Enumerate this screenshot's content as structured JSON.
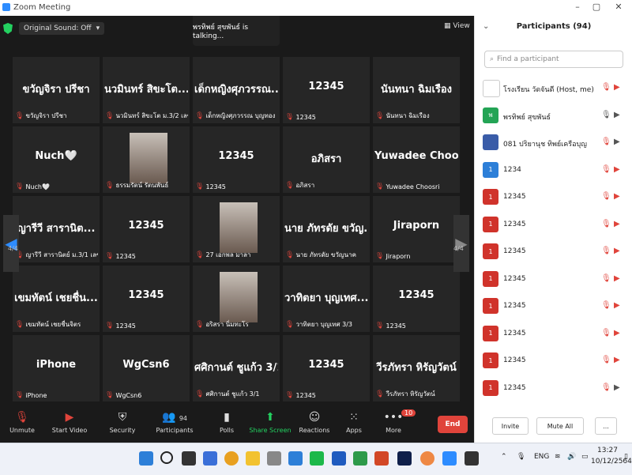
{
  "window": {
    "title": "Zoom Meeting"
  },
  "topbar": {
    "original_sound": "Original Sound: Off",
    "talking": "พรทิพย์ สุขพันธ์ is talking...",
    "view": "View"
  },
  "tiles": [
    {
      "name": "ขวัญจิรา ปรีชา",
      "label": "ขวัญจิรา ปรีชา"
    },
    {
      "name": "นวมินทร์ สิขะโต...",
      "label": "นวมินทร์ สิขะโต ม.3/2 เลขที่28"
    },
    {
      "name": "เด็กหญิงศุภวรรณ...",
      "label": "เด็กหญิงศุภวรรณ บุญทอง"
    },
    {
      "name": "12345",
      "label": "12345"
    },
    {
      "name": "นันทนา ฉิมเรือง",
      "label": "นันทนา ฉิมเรือง"
    },
    {
      "name": "Nuch🤍",
      "label": "Nuch🤍"
    },
    {
      "name": "",
      "label": "ธรรมรัตน์ รัตนพันธ์",
      "photo": true
    },
    {
      "name": "12345",
      "label": "12345"
    },
    {
      "name": "อภิสรา",
      "label": "อภิสรา"
    },
    {
      "name": "Yuwadee Choosri",
      "label": "Yuwadee Choosri"
    },
    {
      "name": "ญารีวี สารานิต...",
      "label": "ญารีวี สารานิตย์ ม.3/1 เลข..."
    },
    {
      "name": "12345",
      "label": "12345"
    },
    {
      "name": "",
      "label": "27 เอกพล มาลา",
      "photo": true
    },
    {
      "name": "นาย ภัทรดัย ขวัญ...",
      "label": "นาย ภัทรดัย ขวัญนาค"
    },
    {
      "name": "Jiraporn",
      "label": "Jiraporn"
    },
    {
      "name": "เขมทัตน์ เชยชื่น...",
      "label": "เขมทัตน์ เชยชื่นจิตร"
    },
    {
      "name": "12345",
      "label": "12345"
    },
    {
      "name": "",
      "label": "อริสรา นิ่มทะโร",
      "photo": true
    },
    {
      "name": "วาทิตยา บุญเทศ...",
      "label": "วาทิตยา บุญเทศ 3/3"
    },
    {
      "name": "12345",
      "label": "12345"
    },
    {
      "name": "iPhone",
      "label": "iPhone"
    },
    {
      "name": "WgCsn6",
      "label": "WgCsn6"
    },
    {
      "name": "ศศิกานต์ ชูแก้ว 3/1",
      "label": "ศศิกานต์ ชูแก้ว 3/1"
    },
    {
      "name": "12345",
      "label": "12345"
    },
    {
      "name": "วีรภัทรา หิรัญวัตน์",
      "label": "วีรภัทรา หิรัญวัตน์"
    }
  ],
  "pager": {
    "left": "4/4",
    "right": "4/4"
  },
  "toolbar": {
    "unmute": "Unmute",
    "start_video": "Start Video",
    "security": "Security",
    "participants": "Participants",
    "participants_count": "94",
    "polls": "Polls",
    "share": "Share Screen",
    "reactions": "Reactions",
    "apps": "Apps",
    "more": "More",
    "more_badge": "10",
    "end": "End"
  },
  "panel": {
    "title": "Participants (94)",
    "search_placeholder": "Find a participant",
    "participants": [
      {
        "name": "โรงเรียน วัดจันดี (Host, me)",
        "color": "#ffffff",
        "avatar": "",
        "mic": "off",
        "cam": "off"
      },
      {
        "name": "พรทิพย์ สุขพันธ์",
        "color": "#23a455",
        "avatar": "พ",
        "mic": "on",
        "cam": "on"
      },
      {
        "name": "081 ปริยานุช ทิพย์เครือบุญ",
        "color": "#3a5ca8",
        "avatar": "",
        "mic": "off",
        "cam": "on"
      },
      {
        "name": "1234",
        "color": "#2d7fd8",
        "avatar": "1",
        "mic": "off",
        "cam": "off"
      },
      {
        "name": "12345",
        "color": "#d0332b",
        "avatar": "1",
        "mic": "off",
        "cam": "off"
      },
      {
        "name": "12345",
        "color": "#d0332b",
        "avatar": "1",
        "mic": "off",
        "cam": "off"
      },
      {
        "name": "12345",
        "color": "#d0332b",
        "avatar": "1",
        "mic": "off",
        "cam": "off"
      },
      {
        "name": "12345",
        "color": "#d0332b",
        "avatar": "1",
        "mic": "off",
        "cam": "off"
      },
      {
        "name": "12345",
        "color": "#d0332b",
        "avatar": "1",
        "mic": "off",
        "cam": "off"
      },
      {
        "name": "12345",
        "color": "#d0332b",
        "avatar": "1",
        "mic": "off",
        "cam": "off"
      },
      {
        "name": "12345",
        "color": "#d0332b",
        "avatar": "1",
        "mic": "off",
        "cam": "off"
      },
      {
        "name": "12345",
        "color": "#d0332b",
        "avatar": "1",
        "mic": "off",
        "cam": "on"
      }
    ],
    "invite": "Invite",
    "mute_all": "Mute All",
    "more": "..."
  },
  "taskbar": {
    "lang": "ENG",
    "time": "13:27",
    "date": "10/12/2564"
  }
}
